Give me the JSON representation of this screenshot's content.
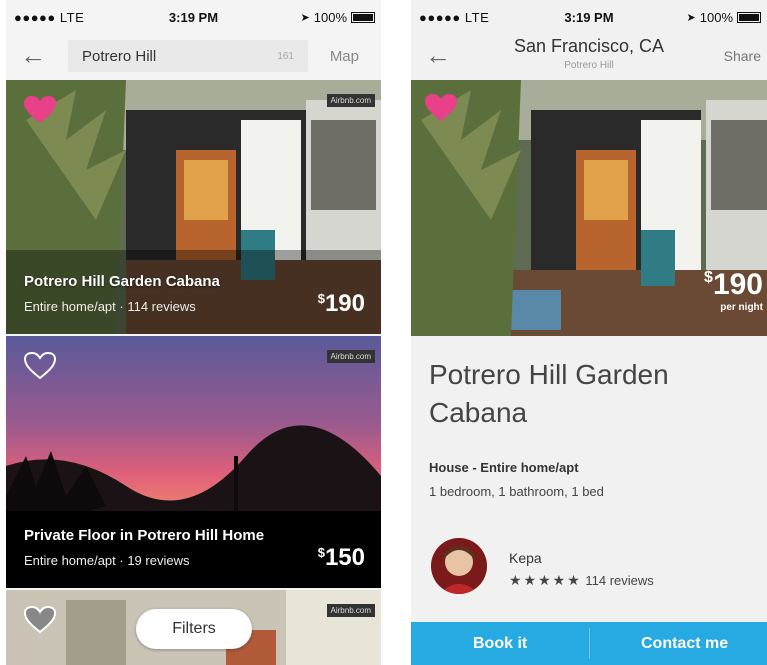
{
  "status_left": {
    "carrier": "●●●●● LTE",
    "time": "3:19 PM",
    "battery": "100%"
  },
  "status_right": {
    "carrier": "●●●●● LTE",
    "time": "3:19 PM",
    "battery": "100%"
  },
  "search": {
    "back": "←",
    "query": "Potrero Hill",
    "count": "161",
    "map_label": "Map"
  },
  "listings": [
    {
      "title": "Potrero Hill Garden Cabana",
      "subtitle": "Entire home/apt · 114 reviews",
      "currency": "$",
      "price": "190",
      "favorited": true,
      "watermark": "Airbnb.com"
    },
    {
      "title": "Private Floor in Potrero Hill Home",
      "subtitle": "Entire home/apt · 19 reviews",
      "currency": "$",
      "price": "150",
      "favorited": false,
      "watermark": "Airbnb.com"
    },
    {
      "title": "",
      "subtitle": "",
      "currency": "",
      "price": "",
      "favorited": false,
      "watermark": "Airbnb.com"
    }
  ],
  "filters_label": "Filters",
  "detail": {
    "back": "←",
    "nav_title": "San Francisco, CA",
    "nav_subtitle": "Potrero Hill",
    "share_label": "Share",
    "currency": "$",
    "price": "190",
    "price_unit": "per night",
    "name": "Potrero Hill Garden Cabana",
    "property_type": "House - Entire home/apt",
    "rooms": "1 bedroom, 1 bathroom, 1 bed",
    "host": {
      "name": "Kepa",
      "stars": "★★★★★",
      "reviews": "114 reviews"
    },
    "book_label": "Book it",
    "contact_label": "Contact me"
  },
  "colors": {
    "heart_active": "#e8418a",
    "action_bar": "#27a9e1"
  }
}
